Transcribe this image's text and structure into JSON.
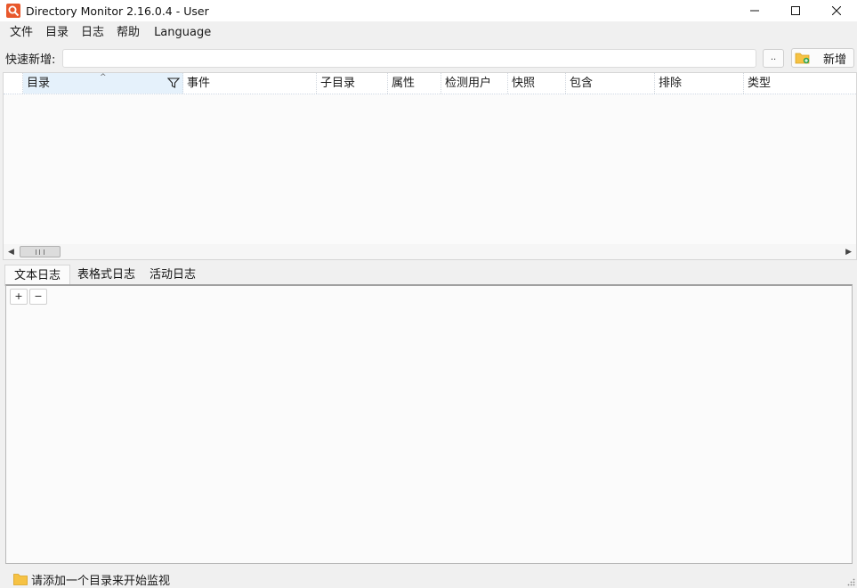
{
  "window": {
    "title": "Directory Monitor 2.16.0.4 - User",
    "icon": "magnifier-app-icon"
  },
  "menu": [
    "文件",
    "目录",
    "日志",
    "帮助",
    "Language"
  ],
  "quick_add": {
    "label": "快速新增:",
    "input_value": "",
    "browse_label": "..",
    "add_label": "新增"
  },
  "grid": {
    "columns": [
      "目录",
      "事件",
      "子目录",
      "属性",
      "检测用户",
      "快照",
      "包含",
      "排除",
      "类型"
    ],
    "rows": []
  },
  "tabs": [
    "文本日志",
    "表格式日志",
    "活动日志"
  ],
  "log_controls": {
    "expand": "+",
    "collapse": "−"
  },
  "status": {
    "text": "请添加一个目录来开始监视"
  },
  "colors": {
    "app_icon": "#e8582c",
    "selected_header": "#e5f1fb",
    "folder": "#f6c244"
  }
}
